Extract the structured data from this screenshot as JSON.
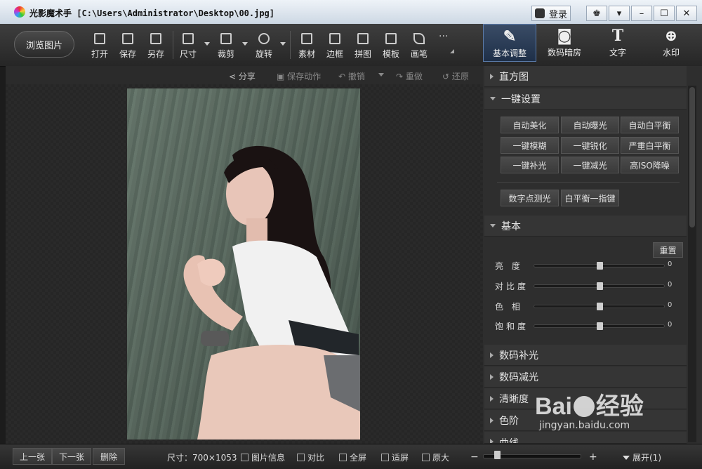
{
  "window": {
    "app_name": "光影魔术手",
    "file_path": "[C:\\Users\\Administrator\\Desktop\\00.jpg]",
    "login_label": "登录",
    "controls": [
      "♚",
      "▾",
      "–",
      "☐",
      "✕"
    ]
  },
  "toolbar": {
    "browse_label": "浏览图片",
    "tools": [
      {
        "label": "打开",
        "icon": "open-icon"
      },
      {
        "label": "保存",
        "icon": "save-icon"
      },
      {
        "label": "另存",
        "icon": "save-as-icon"
      },
      {
        "label": "尺寸",
        "icon": "resize-icon"
      },
      {
        "label": "裁剪",
        "icon": "crop-icon"
      },
      {
        "label": "旋转",
        "icon": "rotate-icon"
      },
      {
        "label": "素材",
        "icon": "star-icon"
      },
      {
        "label": "边框",
        "icon": "frame-icon"
      },
      {
        "label": "拼图",
        "icon": "collage-icon"
      },
      {
        "label": "模板",
        "icon": "template-icon"
      },
      {
        "label": "画笔",
        "icon": "brush-icon"
      }
    ],
    "more_label": "···"
  },
  "panel_tabs": [
    {
      "label": "基本调整",
      "icon": "adjust-icon",
      "glyph": "✎"
    },
    {
      "label": "数码暗房",
      "icon": "camera-icon",
      "glyph": "◙"
    },
    {
      "label": "文字",
      "icon": "text-icon",
      "glyph": "T"
    },
    {
      "label": "水印",
      "icon": "watermark-icon",
      "glyph": "⊕"
    }
  ],
  "subbar": {
    "share": "分享",
    "save_action": "保存动作",
    "undo": "撤销",
    "redo": "重做",
    "restore": "还原"
  },
  "right_panel": {
    "histogram": "直方图",
    "one_click": {
      "title": "一键设置",
      "buttons": [
        "自动美化",
        "自动曝光",
        "自动白平衡",
        "一键模糊",
        "一键锐化",
        "严重白平衡",
        "一键补光",
        "一键减光",
        "高ISO降噪"
      ],
      "extra_buttons": [
        "数字点测光",
        "白平衡一指键"
      ]
    },
    "basic": {
      "title": "基本",
      "reset": "重置",
      "sliders": [
        {
          "label": "亮 度",
          "value": "0",
          "level": 0.5
        },
        {
          "label": "对比度",
          "value": "0",
          "level": 0.5
        },
        {
          "label": "色 相",
          "value": "0",
          "level": 0.5
        },
        {
          "label": "饱和度",
          "value": "0",
          "level": 0.5
        }
      ]
    },
    "sections": [
      "数码补光",
      "数码减光",
      "清晰度",
      "色阶",
      "曲线"
    ]
  },
  "bottom": {
    "prev": "上一张",
    "next": "下一张",
    "delete": "删除",
    "size": "尺寸：700×1053",
    "info": "图片信息",
    "compare": "对比",
    "fullscreen": "全屏",
    "fit": "适屏",
    "original": "原大",
    "zoom_minus": "−",
    "zoom_plus": "+",
    "expand": "展开(1)"
  },
  "watermark": {
    "brand": "Bai",
    "brand2": "经验",
    "url": "jingyan.baidu.com"
  }
}
